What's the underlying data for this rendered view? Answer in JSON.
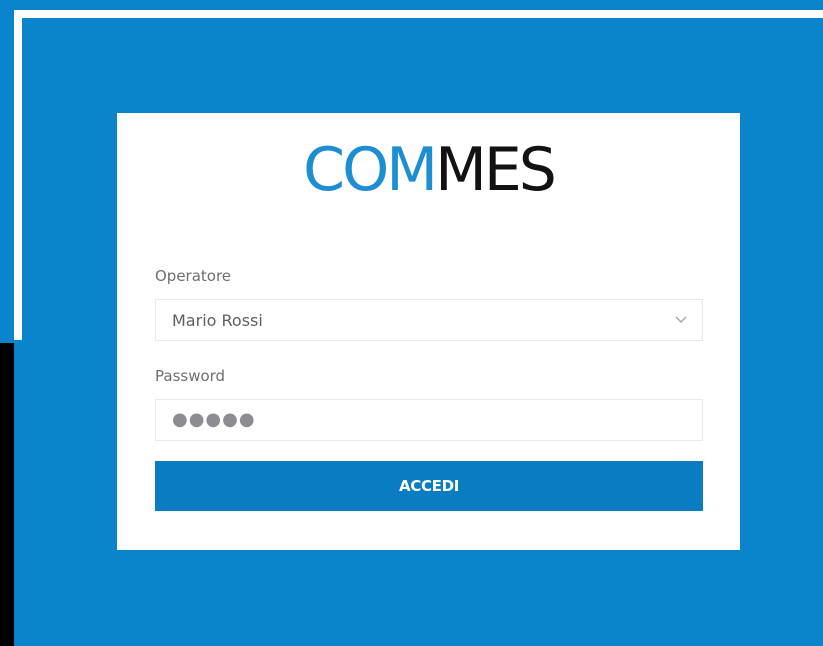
{
  "brand": {
    "logo_part1": "COM",
    "logo_part2": "MES",
    "accent_color": "#1e8ed2",
    "background_color": "#0a84cc"
  },
  "login": {
    "operator_label": "Operatore",
    "operator_value": "Mario Rossi",
    "password_label": "Password",
    "password_value": "●●●●●",
    "submit_label": "ACCEDI"
  },
  "icons": {
    "dropdown": "chevron-down-icon"
  }
}
